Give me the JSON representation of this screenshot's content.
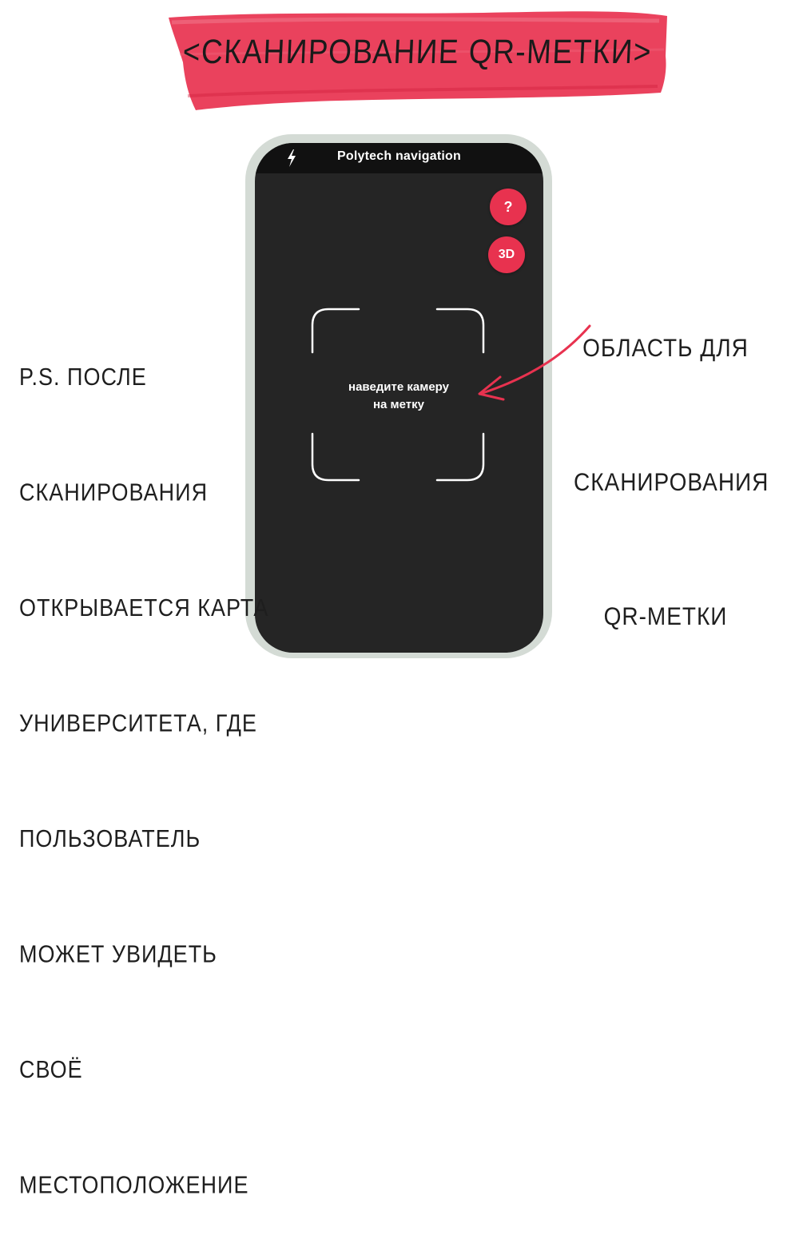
{
  "banner": {
    "title": "<СКАНИРОВАНИЕ   QR-МЕТКИ>",
    "color": "#e8324f"
  },
  "phone": {
    "frame_color": "#d4dbd5",
    "screen_color": "#252525",
    "status_bar": {
      "flash_icon": "lightning-icon",
      "title": "Polytech navigation"
    },
    "buttons": {
      "help_label": "?",
      "view_3d_label": "3D",
      "accent": "#e8324f"
    },
    "scanner": {
      "hint_line1": "наведите камеру",
      "hint_line2": "на метку"
    }
  },
  "annotations": {
    "right_note": [
      "ОБЛАСТЬ ДЛЯ",
      "СКАНИРОВАНИЯ",
      "QR-МЕТКИ"
    ],
    "left_note": [
      "P.S. ПОСЛЕ",
      "СКАНИРОВАНИЯ",
      "ОТКРЫВАЕТСЯ КАРТА",
      "УНИВЕРСИТЕТА, ГДЕ",
      "ПОЛЬЗОВАТЕЛЬ",
      "МОЖЕТ УВИДЕТЬ",
      "СВОЁ",
      "МЕСТОПОЛОЖЕНИЕ"
    ],
    "arrow_color": "#e8324f"
  }
}
